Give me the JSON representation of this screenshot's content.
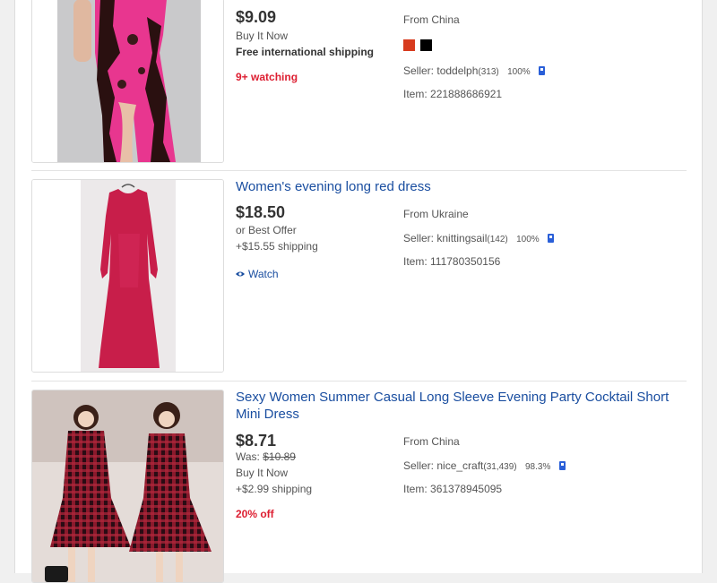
{
  "listings": [
    {
      "price": "$9.09",
      "buy_format": "Buy It Now",
      "shipping": "Free international shipping",
      "watching": "9+ watching",
      "location": "From China",
      "swatch_colors": [
        "#d73b1e",
        "#000000"
      ],
      "seller_prefix": "Seller:",
      "seller_name": "toddelph",
      "seller_feedback": "(313)",
      "seller_percent": "100%",
      "item_label": "Item:",
      "item_number": "221888686921",
      "image_icon": "pink-lace-dress-photo"
    },
    {
      "title": "Women's evening long red dress",
      "price": "$18.50",
      "buy_format": "or Best Offer",
      "shipping": "+$15.55 shipping",
      "watch_label": "Watch",
      "location": "From Ukraine",
      "seller_prefix": "Seller:",
      "seller_name": "knittingsail",
      "seller_feedback": "(142)",
      "seller_percent": "100%",
      "item_label": "Item:",
      "item_number": "111780350156",
      "image_icon": "red-long-dress-photo"
    },
    {
      "title": "Sexy Women Summer Casual Long Sleeve Evening Party Cocktail Short Mini Dress",
      "price": "$8.71",
      "was_label": "Was:",
      "was_price": "$10.89",
      "buy_format": "Buy It Now",
      "shipping": "+$2.99 shipping",
      "discount": "20% off",
      "location": "From China",
      "seller_prefix": "Seller:",
      "seller_name": "nice_craft",
      "seller_feedback": "(31,439)",
      "seller_percent": "98.3%",
      "item_label": "Item:",
      "item_number": "361378945095",
      "image_icon": "plaid-mini-dress-photo"
    }
  ],
  "colors": {
    "link": "#1a4ea0",
    "alert": "#dd1e31",
    "seller_badge": "#2a5fd8"
  }
}
